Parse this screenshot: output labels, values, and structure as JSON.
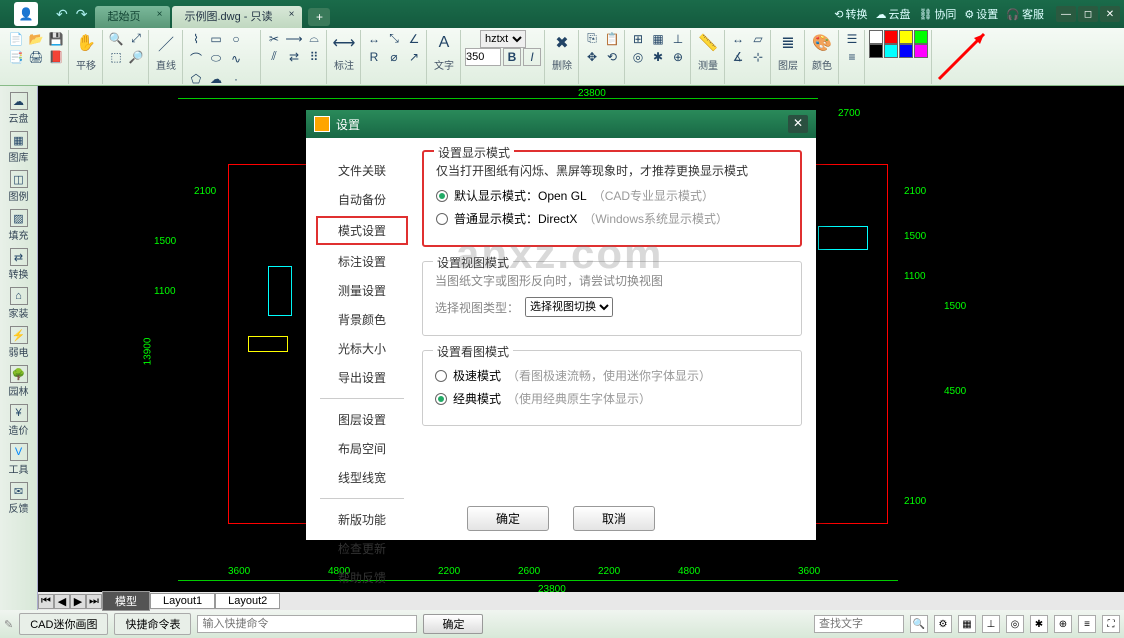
{
  "titlebar": {
    "tab1": "起始页",
    "tab2": "示例图.dwg - 只读",
    "links": {
      "convert": "转换",
      "cloud": "云盘",
      "collab": "协同",
      "settings": "设置",
      "service": "客服"
    }
  },
  "ribbon": {
    "move": "平移",
    "line": "直线",
    "annot": "标注",
    "text": "文字",
    "del": "删除",
    "measure": "测量",
    "layer": "图层",
    "color": "颜色",
    "font_name": "hztxt",
    "font_size": "350"
  },
  "side": {
    "cloud": "云盘",
    "lib": "图库",
    "legend": "图例",
    "fill": "填充",
    "convert": "转换",
    "decor": "家装",
    "elec": "弱电",
    "garden": "园林",
    "cost": "造价",
    "tool": "工具",
    "feedback": "反馈"
  },
  "dialog": {
    "title": "设置",
    "nav": {
      "file": "文件关联",
      "backup": "自动备份",
      "mode": "模式设置",
      "annot": "标注设置",
      "measure": "测量设置",
      "bg": "背景颜色",
      "cursor": "光标大小",
      "export": "导出设置",
      "layer": "图层设置",
      "layout": "布局空间",
      "linew": "线型线宽",
      "newfn": "新版功能",
      "check": "检查更新",
      "help": "帮助反馈"
    },
    "display": {
      "legend": "设置显示模式",
      "hint": "仅当打开图纸有闪烁、黑屏等现象时，才推荐更换显示模式",
      "opt1": "默认显示模式：Open GL",
      "opt1_note": "（CAD专业显示模式）",
      "opt2": "普通显示模式：DirectX",
      "opt2_note": "（Windows系统显示模式）"
    },
    "view": {
      "legend": "设置视图模式",
      "hint": "当图纸文字或图形反向时，请尝试切换视图",
      "select_label": "选择视图类型：",
      "select_value": "选择视图切换"
    },
    "look": {
      "legend": "设置看图模式",
      "opt1": "极速模式",
      "opt1_note": "（看图极速流畅，使用迷你字体显示）",
      "opt2": "经典模式",
      "opt2_note": "（使用经典原生字体显示）"
    },
    "ok": "确定",
    "cancel": "取消"
  },
  "layout": {
    "model": "模型",
    "l1": "Layout1",
    "l2": "Layout2"
  },
  "bottom": {
    "app": "CAD迷你画图",
    "quick": "快捷命令表",
    "cmd_ph": "输入快捷命令",
    "ok": "确定",
    "find_ph": "查找文字"
  },
  "dims": {
    "top": "23800",
    "topright": "2700",
    "right1": "2100",
    "right2": "1500",
    "right3": "1100",
    "right4": "1500",
    "right5": "4500",
    "right6": "2100",
    "left1": "2100",
    "left2": "1500",
    "left3": "1100",
    "left4": "13900",
    "b1": "3600",
    "b2": "4800",
    "b3": "2200",
    "b4": "2600",
    "b5": "2200",
    "b6": "4800",
    "b7": "3600",
    "bfull": "23800"
  },
  "watermark": "anxz.com"
}
